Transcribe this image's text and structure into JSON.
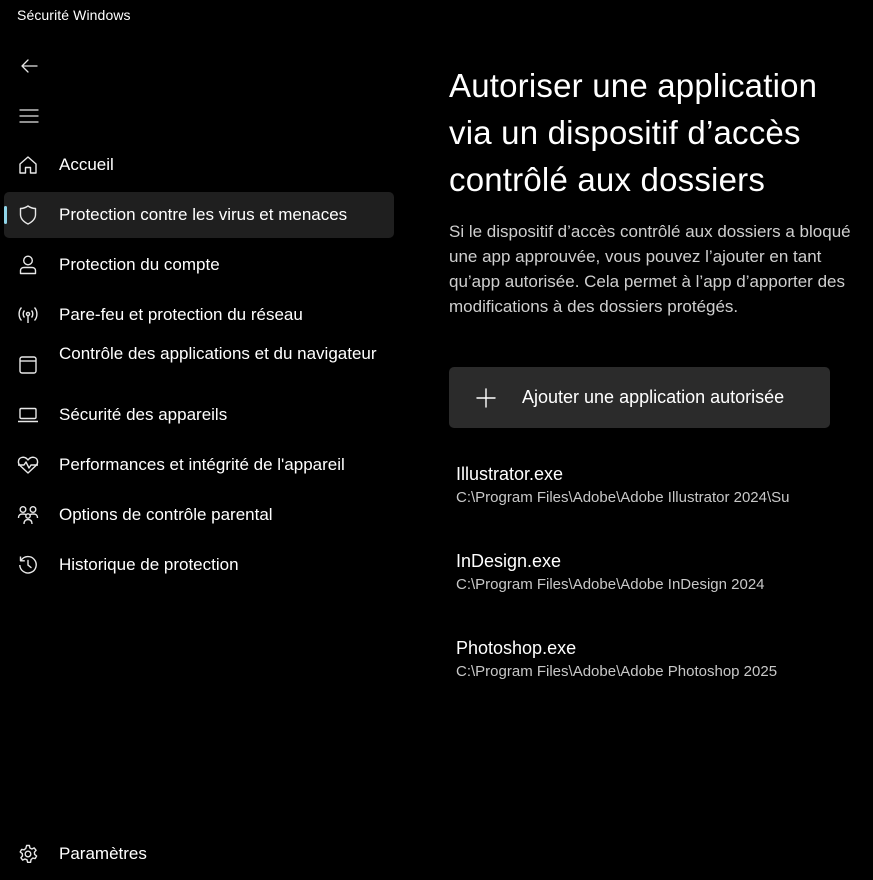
{
  "window": {
    "title": "Sécurité Windows"
  },
  "nav": {
    "items": [
      {
        "label": "Accueil",
        "icon": "home-icon"
      },
      {
        "label": "Protection contre les virus et menaces",
        "icon": "shield-icon",
        "active": true
      },
      {
        "label": "Protection du compte",
        "icon": "person-icon"
      },
      {
        "label": "Pare-feu et protection du réseau",
        "icon": "wifi-antenna-icon"
      },
      {
        "label": "Contrôle des applications et du navigateur",
        "icon": "app-window-icon"
      },
      {
        "label": "Sécurité des appareils",
        "icon": "laptop-icon"
      },
      {
        "label": "Performances et intégrité de l'appareil",
        "icon": "heart-pulse-icon"
      },
      {
        "label": "Options de contrôle parental",
        "icon": "family-icon"
      },
      {
        "label": "Historique de protection",
        "icon": "history-icon"
      }
    ],
    "settings_label": "Paramètres"
  },
  "main": {
    "title": "Autoriser une application via un dispositif d’accès contrôlé aux dossiers",
    "description": "Si le dispositif d’accès contrôlé aux dossiers a bloqué une app approuvée, vous pouvez l’ajouter en tant qu’app autorisée. Cela permet à l’app d’apporter des modifications à des dossiers protégés.",
    "add_button_label": "Ajouter une application autorisée",
    "apps": [
      {
        "name": "Illustrator.exe",
        "path": "C:\\Program Files\\Adobe\\Adobe Illustrator 2024\\Su"
      },
      {
        "name": "InDesign.exe",
        "path": "C:\\Program Files\\Adobe\\Adobe InDesign 2024"
      },
      {
        "name": "Photoshop.exe",
        "path": "C:\\Program Files\\Adobe\\Adobe Photoshop 2025"
      }
    ]
  },
  "colors": {
    "background": "#000000",
    "active_item_bg": "#1f1f1f",
    "accent_indicator": "#8fd4e8",
    "button_bg": "#2b2b2b"
  }
}
